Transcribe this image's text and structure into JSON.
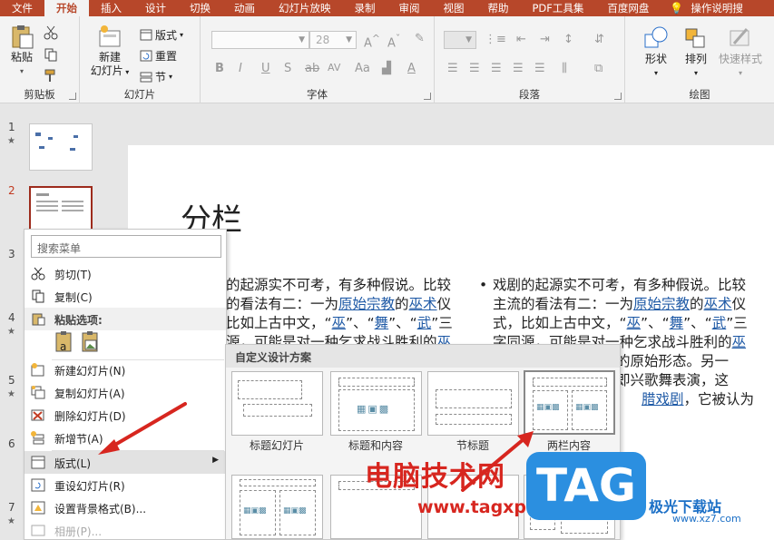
{
  "tabs": [
    "文件",
    "开始",
    "插入",
    "设计",
    "切换",
    "动画",
    "幻灯片放映",
    "录制",
    "审阅",
    "视图",
    "帮助",
    "PDF工具集",
    "百度网盘",
    "操作说明搜"
  ],
  "active_tab": "开始",
  "ribbon": {
    "clipboard": {
      "paste": "粘贴",
      "label": "剪贴板"
    },
    "slides": {
      "new_slide_line1": "新建",
      "new_slide_line2": "幻灯片",
      "layout": "版式",
      "reset": "重置",
      "section": "节",
      "label": "幻灯片"
    },
    "font": {
      "size": "28",
      "label": "字体",
      "bold": "B",
      "italic": "I",
      "underline": "U",
      "strike": "S",
      "shadow": "ab",
      "spacing": "AV",
      "case": "Aa",
      "color": "A"
    },
    "paragraph": {
      "label": "段落"
    },
    "drawing": {
      "shapes": "形状",
      "arrange": "排列",
      "quick_styles": "快速样式",
      "label": "绘图"
    }
  },
  "slides_pane": [
    {
      "num": "1",
      "star": "★"
    },
    {
      "num": "2",
      "star": "★"
    },
    {
      "num": "3",
      "star": "★"
    },
    {
      "num": "4",
      "star": "★"
    },
    {
      "num": "5",
      "star": "★"
    },
    {
      "num": "6",
      "star": "★"
    },
    {
      "num": "7",
      "star": "★"
    }
  ],
  "slide": {
    "title": "分栏",
    "col_left": [
      "的起源实不可考，有多种假说。比较",
      "的看法有二：一为",
      "比如上古中文，“",
      "源，可能是对一种乞求战斗胜利的"
    ],
    "col_left_links": {
      "l2a": "原始宗教",
      "l2b": "的",
      "l2c": "巫术",
      "l2d": "仪",
      "l3a": "巫",
      "l3b": "”、“",
      "l3c": "舞",
      "l3d": "”、“",
      "l3e": "武",
      "l3f": "”三",
      "l4": "巫"
    },
    "col_right": [
      "戏剧的起源实不可考，有多种假说。比较",
      "主流的看法有二：一为",
      "式，比如上古中文，“",
      "字同源，可能是对一种乞求战斗胜利的",
      "",
      "",
      ""
    ],
    "col_right_tail": {
      "r2a": "原始宗教",
      "r2b": "的",
      "r2c": "巫术",
      "r2d": "仪",
      "r3a": "巫",
      "r3b": "”、“",
      "r3c": "舞",
      "r3d": "”、“",
      "r3e": "武",
      "r3f": "”三",
      "r4": "巫",
      "r5": "的原始形态。另一",
      "r6": "即兴歌舞表演，这",
      "r7a": "腊戏剧",
      "r7b": "，它被认为"
    }
  },
  "context_menu": {
    "search_placeholder": "搜索菜单",
    "items": {
      "cut": "剪切(T)",
      "copy": "复制(C)",
      "paste_options": "粘贴选项:",
      "new_slide": "新建幻灯片(N)",
      "duplicate": "复制幻灯片(A)",
      "delete": "删除幻灯片(D)",
      "new_section": "新增节(A)",
      "layout": "版式(L)",
      "reset": "重设幻灯片(R)",
      "background": "设置背景格式(B)...",
      "album": "相册(P)..."
    }
  },
  "layout_submenu": {
    "header": "自定义设计方案",
    "layouts": [
      "标题幻灯片",
      "标题和内容",
      "节标题",
      "两栏内容"
    ],
    "selected": "两栏内容"
  },
  "watermark": {
    "text": "电脑技术网",
    "url": "www.tagxp.com",
    "badge": "TAG",
    "site_name": "极光下载站",
    "site_url": "www.xz7.com"
  },
  "colors": {
    "accent": "#b7472a",
    "link": "#1f5aa6",
    "arrow": "#d7261f"
  }
}
